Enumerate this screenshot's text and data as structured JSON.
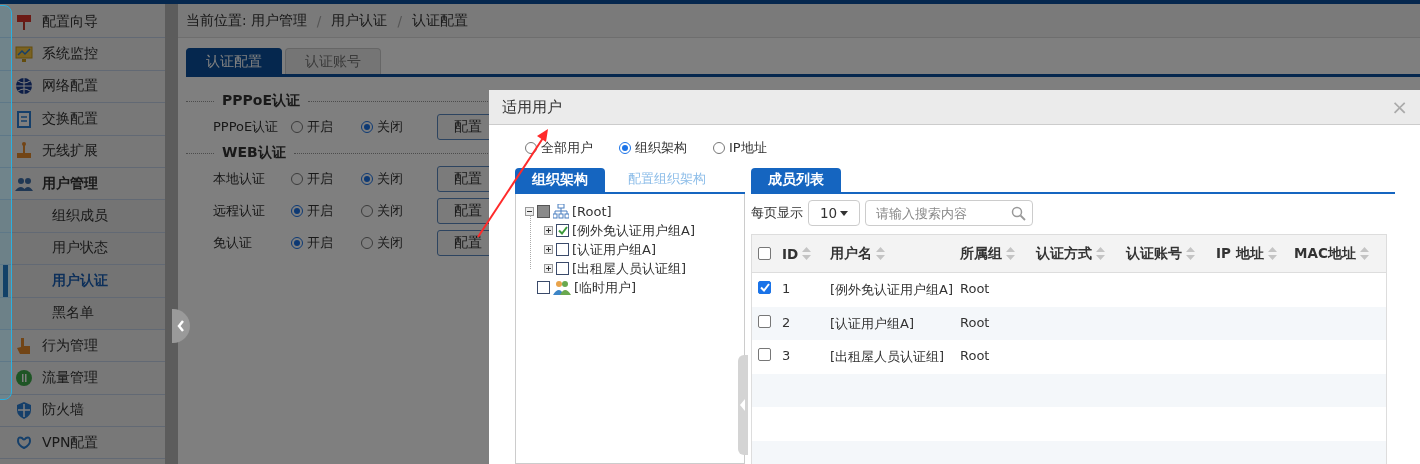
{
  "sidebar": {
    "items": [
      {
        "label": "配置向导",
        "expanded": false
      },
      {
        "label": "系统监控",
        "expanded": false
      },
      {
        "label": "网络配置",
        "expanded": false
      },
      {
        "label": "交换配置",
        "expanded": false
      },
      {
        "label": "无线扩展",
        "expanded": false
      },
      {
        "label": "用户管理",
        "expanded": true,
        "children": [
          {
            "label": "组织成员",
            "selected": false
          },
          {
            "label": "用户状态",
            "selected": false
          },
          {
            "label": "用户认证",
            "selected": true
          },
          {
            "label": "黑名单",
            "selected": false
          }
        ]
      },
      {
        "label": "行为管理",
        "expanded": false
      },
      {
        "label": "流量管理",
        "expanded": false
      },
      {
        "label": "防火墙",
        "expanded": false
      },
      {
        "label": "VPN配置",
        "expanded": false
      }
    ]
  },
  "breadcrumb": {
    "separator": "/",
    "items": [
      "当前位置: 用户管理",
      "用户认证",
      "认证配置"
    ]
  },
  "tabs": [
    {
      "label": "认证配置",
      "selected": true
    },
    {
      "label": "认证账号",
      "selected": false
    }
  ],
  "sections": [
    {
      "title": "PPPoE认证",
      "rows": [
        {
          "label": "PPPoE认证",
          "options": [
            {
              "label": "开启",
              "selected": false
            },
            {
              "label": "关闭",
              "selected": true
            }
          ],
          "button": "配置"
        }
      ]
    },
    {
      "title": "WEB认证",
      "rows": [
        {
          "label": "本地认证",
          "options": [
            {
              "label": "开启",
              "selected": false
            },
            {
              "label": "关闭",
              "selected": true
            }
          ],
          "button": "配置"
        },
        {
          "label": "远程认证",
          "options": [
            {
              "label": "开启",
              "selected": true
            },
            {
              "label": "关闭",
              "selected": false
            }
          ],
          "button": "配置"
        },
        {
          "label": "免认证",
          "options": [
            {
              "label": "开启",
              "selected": true
            },
            {
              "label": "关闭",
              "selected": false
            }
          ],
          "button": "配置"
        }
      ]
    }
  ],
  "dialog": {
    "title": "适用用户",
    "close": "×",
    "scope_options": [
      {
        "label": "全部用户",
        "selected": false
      },
      {
        "label": "组织架构",
        "selected": true
      },
      {
        "label": "IP地址",
        "selected": false
      }
    ],
    "org_panel": {
      "tab": "组织架构",
      "link": "配置组织架构",
      "tree": [
        {
          "label": "[Root]",
          "kind": "root",
          "expanded": true,
          "checked": false,
          "partial": true,
          "children": [
            {
              "label": "[例外免认证用户组A]",
              "kind": "group",
              "expanded": false,
              "checked": true,
              "partial": false
            },
            {
              "label": "[认证用户组A]",
              "kind": "group",
              "expanded": false,
              "checked": false,
              "partial": false
            },
            {
              "label": "[出租屋人员认证组]",
              "kind": "group",
              "expanded": false,
              "checked": false,
              "partial": false
            }
          ]
        },
        {
          "label": "[临时用户]",
          "kind": "users",
          "checked": false,
          "partial": false
        }
      ]
    },
    "member_panel": {
      "tab": "成员列表",
      "page_size_label": "每页显示",
      "page_size": "10",
      "search": {
        "placeholder": "请输入搜索内容"
      },
      "table": {
        "select_all": false,
        "columns": [
          "ID",
          "用户名",
          "所属组",
          "认证方式",
          "认证账号",
          "IP 地址",
          "MAC地址"
        ],
        "rows": [
          {
            "checked": true,
            "cells": [
              "1",
              "[例外免认证用户组A]",
              "Root"
            ]
          },
          {
            "checked": false,
            "cells": [
              "2",
              "[认证用户组A]",
              "Root"
            ]
          },
          {
            "checked": false,
            "cells": [
              "3",
              "[出租屋人员认证组]",
              "Root"
            ]
          }
        ]
      }
    }
  }
}
